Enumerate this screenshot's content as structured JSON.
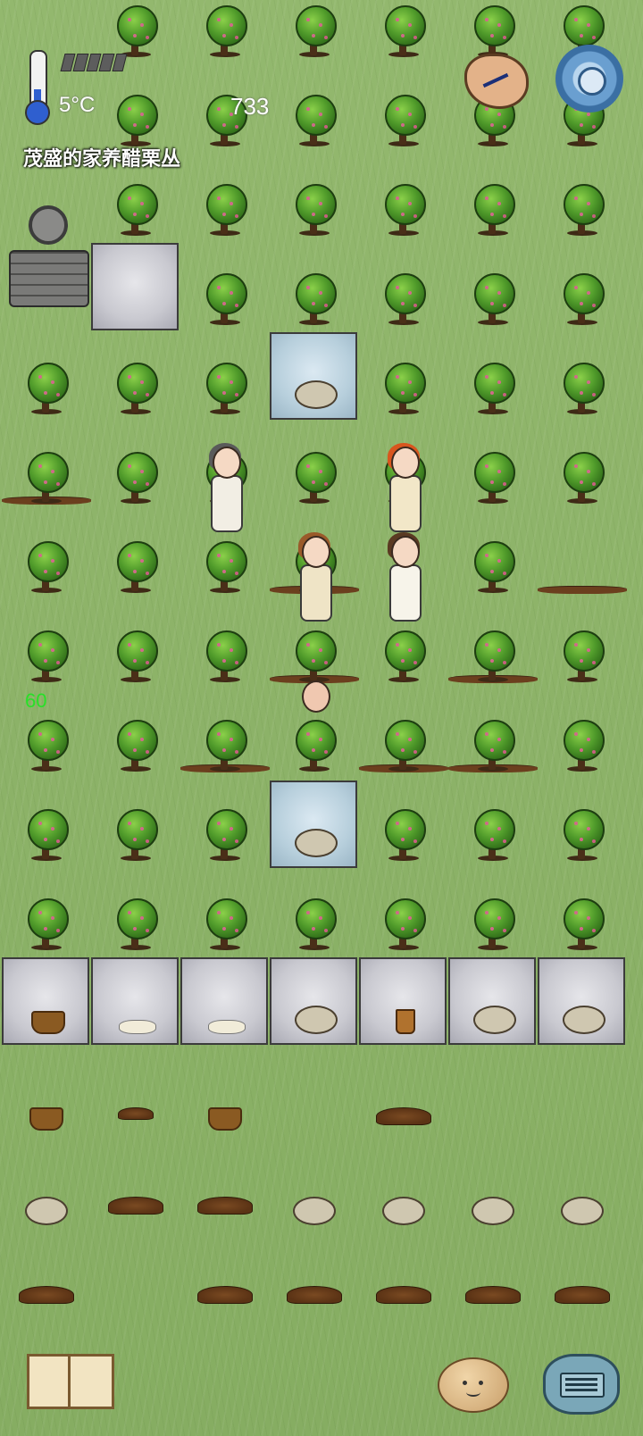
{
  "hud": {
    "temperature": "5°C",
    "yum_counter": "733",
    "hovered_object": "茂盛的家养醋栗丛",
    "age": "60",
    "food_pips": 5,
    "temperature_level": 0.3,
    "thermometer_icon": "thermometer-icon",
    "clock_icon": "clock-icon",
    "settings_icon": "gear-icon",
    "book_icon": "book-icon",
    "emote_icon": "emote-face-icon",
    "chat_icon": "keyboard-icon"
  },
  "colors": {
    "grass": "#8fb56a",
    "age_text": "#28e028",
    "hud_text": "#ffffff",
    "gear": "#6a9fd0"
  },
  "world": {
    "bushes": [
      [
        1,
        0
      ],
      [
        2,
        0
      ],
      [
        3,
        0
      ],
      [
        4,
        0
      ],
      [
        5,
        0
      ],
      [
        6,
        0
      ],
      [
        1,
        1
      ],
      [
        2,
        1
      ],
      [
        3,
        1
      ],
      [
        4,
        1
      ],
      [
        5,
        1
      ],
      [
        6,
        1
      ],
      [
        1,
        2
      ],
      [
        2,
        2
      ],
      [
        3,
        2
      ],
      [
        4,
        2
      ],
      [
        5,
        2
      ],
      [
        6,
        2
      ],
      [
        2,
        3
      ],
      [
        3,
        3
      ],
      [
        4,
        3
      ],
      [
        5,
        3
      ],
      [
        6,
        3
      ],
      [
        0,
        4
      ],
      [
        1,
        4
      ],
      [
        2,
        4
      ],
      [
        4,
        4
      ],
      [
        5,
        4
      ],
      [
        6,
        4
      ],
      [
        0,
        5
      ],
      [
        1,
        5
      ],
      [
        2,
        5
      ],
      [
        3,
        5
      ],
      [
        4,
        5
      ],
      [
        5,
        5
      ],
      [
        6,
        5
      ],
      [
        0,
        6
      ],
      [
        1,
        6
      ],
      [
        2,
        6
      ],
      [
        3,
        6
      ],
      [
        5,
        6
      ],
      [
        0,
        7
      ],
      [
        1,
        7
      ],
      [
        2,
        7
      ],
      [
        3,
        7
      ],
      [
        4,
        7
      ],
      [
        5,
        7
      ],
      [
        6,
        7
      ],
      [
        0,
        8
      ],
      [
        1,
        8
      ],
      [
        2,
        8
      ],
      [
        3,
        8
      ],
      [
        4,
        8
      ],
      [
        5,
        8
      ],
      [
        6,
        8
      ],
      [
        0,
        9
      ],
      [
        1,
        9
      ],
      [
        2,
        9
      ],
      [
        4,
        9
      ],
      [
        5,
        9
      ],
      [
        6,
        9
      ],
      [
        0,
        10
      ],
      [
        1,
        10
      ],
      [
        2,
        10
      ],
      [
        3,
        10
      ],
      [
        4,
        10
      ],
      [
        5,
        10
      ],
      [
        6,
        10
      ]
    ],
    "furrows": [
      [
        0,
        5
      ],
      [
        3,
        6
      ],
      [
        3,
        7
      ],
      [
        5,
        7
      ],
      [
        2,
        8
      ],
      [
        4,
        8
      ],
      [
        5,
        8
      ],
      [
        6,
        6
      ]
    ],
    "floor_tiles": [
      {
        "col": 1,
        "row": 3,
        "kind": "stone",
        "item": "none"
      },
      {
        "col": 3,
        "row": 4,
        "kind": "blue",
        "item": "rabbit"
      },
      {
        "col": 3,
        "row": 9,
        "kind": "blue",
        "item": "rabbit"
      },
      {
        "col": 0,
        "row": 11,
        "kind": "stone",
        "item": "basket"
      },
      {
        "col": 1,
        "row": 11,
        "kind": "stone",
        "item": "cloth"
      },
      {
        "col": 2,
        "row": 11,
        "kind": "stone",
        "item": "cloth"
      },
      {
        "col": 3,
        "row": 11,
        "kind": "stone",
        "item": "rabbit"
      },
      {
        "col": 4,
        "row": 11,
        "kind": "stone",
        "item": "bucket"
      },
      {
        "col": 5,
        "row": 11,
        "kind": "stone",
        "item": "rabbit"
      },
      {
        "col": 6,
        "row": 11,
        "kind": "stone",
        "item": "rabbit"
      }
    ],
    "ground_items": [
      {
        "col": 0,
        "row": 12,
        "item": "basket"
      },
      {
        "col": 1,
        "row": 12,
        "item": "pile-small"
      },
      {
        "col": 2,
        "row": 12,
        "item": "basket"
      },
      {
        "col": 4,
        "row": 12,
        "item": "pile"
      },
      {
        "col": 0,
        "row": 13,
        "item": "rabbit"
      },
      {
        "col": 1,
        "row": 13,
        "item": "pile"
      },
      {
        "col": 2,
        "row": 13,
        "item": "pile"
      },
      {
        "col": 3,
        "row": 13,
        "item": "rabbit"
      },
      {
        "col": 4,
        "row": 13,
        "item": "rabbit"
      },
      {
        "col": 5,
        "row": 13,
        "item": "rabbit"
      },
      {
        "col": 6,
        "row": 13,
        "item": "rabbit"
      },
      {
        "col": 0,
        "row": 14,
        "item": "pile"
      },
      {
        "col": 2,
        "row": 14,
        "item": "pile"
      },
      {
        "col": 3,
        "row": 14,
        "item": "pile"
      },
      {
        "col": 4,
        "row": 14,
        "item": "pile"
      },
      {
        "col": 5,
        "row": 14,
        "item": "pile"
      },
      {
        "col": 6,
        "row": 14,
        "item": "pile"
      }
    ],
    "people": [
      {
        "col": 2,
        "row": 5,
        "hair": "#5a5a5a",
        "outfit": "#f2eee4"
      },
      {
        "col": 4,
        "row": 5,
        "hair": "#d8561e",
        "outfit": "#f2e7c8"
      },
      {
        "col": 3,
        "row": 6,
        "hair": "#9a5a2a",
        "outfit": "#efe4c6"
      },
      {
        "col": 4,
        "row": 6,
        "hair": "#5a3a22",
        "outfit": "#f7f4ea"
      },
      {
        "col": 3,
        "row": 7,
        "hair": "none",
        "outfit": "#f0c8b0",
        "baby": true
      }
    ]
  }
}
